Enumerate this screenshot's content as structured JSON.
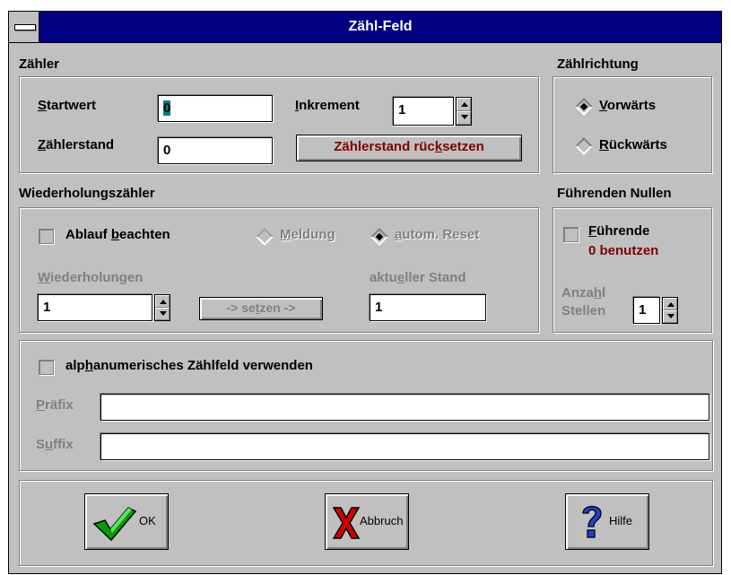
{
  "window": {
    "title": "Zähl-Feld"
  },
  "zaehler": {
    "group_label": "Zähler",
    "startwert_label": "Startwert",
    "startwert_value": "0",
    "inkrement_label": "Inkrement",
    "inkrement_value": "1",
    "zaehlerstand_label": "Zählerstand",
    "zaehlerstand_value": "0",
    "reset_button": "Zählerstand rücksetzen"
  },
  "zaehlrichtung": {
    "group_label": "Zählrichtung",
    "vorwaerts_label": "Vorwärts",
    "vorwaerts_selected": true,
    "rueckwaerts_label": "Rückwärts"
  },
  "wiederholung": {
    "group_label": "Wiederholungszähler",
    "ablauf_label": "Ablauf beachten",
    "meldung_label": "Meldung",
    "autom_reset_label": "autom. Reset",
    "wiederholungen_label": "Wiederholungen",
    "wiederholungen_value": "1",
    "setzen_button": "-> setzen ->",
    "aktueller_stand_label": "aktueller Stand",
    "aktueller_stand_value": "1"
  },
  "nullen": {
    "group_label": "Führenden Nullen",
    "fuehrende_label_1": "Führende",
    "fuehrende_label_2": "0 benutzen",
    "anzahl_label_1": "Anzahl",
    "anzahl_label_2": "Stellen",
    "anzahl_value": "1"
  },
  "alpha": {
    "checkbox_label": "alphanumerisches Zählfeld verwenden",
    "praefix_label": "Präfix",
    "praefix_value": "",
    "suffix_label": "Suffix",
    "suffix_value": ""
  },
  "buttons": {
    "ok": "OK",
    "abbruch": "Abbruch",
    "hilfe": "Hilfe"
  },
  "colors": {
    "title_bar": "#000080",
    "dialog_face": "#c0c0c0",
    "accent_red": "#800000"
  }
}
